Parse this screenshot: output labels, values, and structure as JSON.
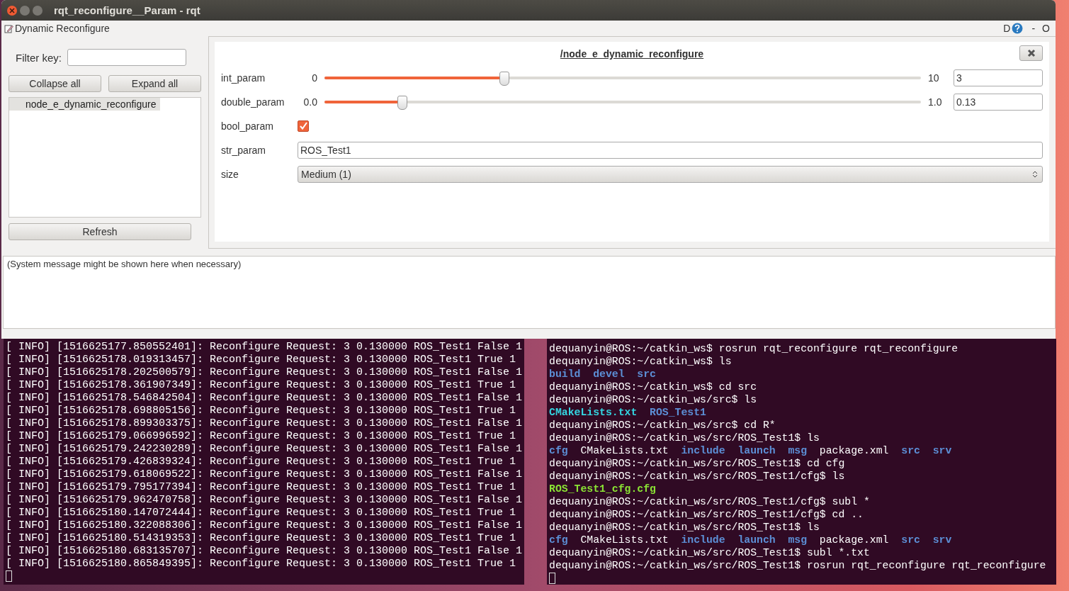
{
  "window": {
    "title": "rqt_reconfigure__Param - rqt"
  },
  "plugin": {
    "title": "Dynamic Reconfigure",
    "controls": [
      "D",
      "-",
      "O"
    ]
  },
  "filter": {
    "label": "Filter key:"
  },
  "buttons": [
    "Collapse all",
    "Expand all"
  ],
  "tree": [
    {
      "label": "node_e_dynamic_reconfigure",
      "selected": true
    }
  ],
  "refresh": "Refresh",
  "node": {
    "title": "/node_e_dynamic_reconfigure",
    "params": [
      {
        "kind": "slider",
        "name": "int_param",
        "min": "0",
        "max": "10",
        "level": 0.3,
        "value": "3"
      },
      {
        "kind": "slider",
        "name": "double_param",
        "min": "0.0",
        "max": "1.0",
        "level": 0.13,
        "value": "0.13"
      },
      {
        "kind": "checkbox",
        "name": "bool_param",
        "checked": true
      },
      {
        "kind": "text",
        "name": "str_param",
        "value": "ROS_Test1"
      },
      {
        "kind": "dropdown",
        "name": "size",
        "value": "Medium (1)"
      }
    ]
  },
  "message": "(System message might be shown here when necessary)",
  "terminal_left": {
    "lines": [
      "[ INFO] [1516625177.850552401]: Reconfigure Request: 3 0.130000 ROS_Test1 False 1",
      "[ INFO] [1516625178.019313457]: Reconfigure Request: 3 0.130000 ROS_Test1 True 1",
      "[ INFO] [1516625178.202500579]: Reconfigure Request: 3 0.130000 ROS_Test1 False 1",
      "[ INFO] [1516625178.361907349]: Reconfigure Request: 3 0.130000 ROS_Test1 True 1",
      "[ INFO] [1516625178.546842504]: Reconfigure Request: 3 0.130000 ROS_Test1 False 1",
      "[ INFO] [1516625178.698805156]: Reconfigure Request: 3 0.130000 ROS_Test1 True 1",
      "[ INFO] [1516625178.899303375]: Reconfigure Request: 3 0.130000 ROS_Test1 False 1",
      "[ INFO] [1516625179.066996592]: Reconfigure Request: 3 0.130000 ROS_Test1 True 1",
      "[ INFO] [1516625179.242230289]: Reconfigure Request: 3 0.130000 ROS_Test1 False 1",
      "[ INFO] [1516625179.426839324]: Reconfigure Request: 3 0.130000 ROS_Test1 True 1",
      "[ INFO] [1516625179.618069522]: Reconfigure Request: 3 0.130000 ROS_Test1 False 1",
      "[ INFO] [1516625179.795177394]: Reconfigure Request: 3 0.130000 ROS_Test1 True 1",
      "[ INFO] [1516625179.962470758]: Reconfigure Request: 3 0.130000 ROS_Test1 False 1",
      "[ INFO] [1516625180.147072444]: Reconfigure Request: 3 0.130000 ROS_Test1 True 1",
      "[ INFO] [1516625180.322088306]: Reconfigure Request: 3 0.130000 ROS_Test1 False 1",
      "[ INFO] [1516625180.514319353]: Reconfigure Request: 3 0.130000 ROS_Test1 True 1",
      "[ INFO] [1516625180.683135707]: Reconfigure Request: 3 0.130000 ROS_Test1 False 1",
      "[ INFO] [1516625180.865849395]: Reconfigure Request: 3 0.130000 ROS_Test1 True 1"
    ]
  },
  "terminal_right": {
    "lines": [
      {
        "kind": "prompt",
        "prompt": "dequanyin@ROS:~/catkin_ws$",
        "command": "rosrun rqt_reconfigure rqt_reconfigure"
      },
      {
        "kind": "prompt",
        "prompt": "dequanyin@ROS:~/catkin_ws$",
        "command": "ls"
      },
      {
        "kind": "listing",
        "entries": [
          {
            "text": "build",
            "color": "#5c8fd6",
            "bold": true
          },
          {
            "text": "devel",
            "color": "#5c8fd6",
            "bold": true
          },
          {
            "text": "src",
            "color": "#5c8fd6",
            "bold": true
          }
        ]
      },
      {
        "kind": "prompt",
        "prompt": "dequanyin@ROS:~/catkin_ws$",
        "command": "cd src"
      },
      {
        "kind": "prompt",
        "prompt": "dequanyin@ROS:~/catkin_ws/src$",
        "command": "ls"
      },
      {
        "kind": "listing",
        "entries": [
          {
            "text": "CMakeLists.txt",
            "color": "#34d6e2",
            "bold": true
          },
          {
            "text": "ROS_Test1",
            "color": "#5c8fd6",
            "bold": true
          }
        ]
      },
      {
        "kind": "prompt",
        "prompt": "dequanyin@ROS:~/catkin_ws/src$",
        "command": "cd R*"
      },
      {
        "kind": "prompt",
        "prompt": "dequanyin@ROS:~/catkin_ws/src/ROS_Test1$",
        "command": "ls"
      },
      {
        "kind": "listing",
        "entries": [
          {
            "text": "cfg",
            "color": "#5c8fd6",
            "bold": true
          },
          {
            "text": "CMakeLists.txt",
            "color": "#ffffff",
            "bold": false
          },
          {
            "text": "include",
            "color": "#5c8fd6",
            "bold": true
          },
          {
            "text": "launch",
            "color": "#5c8fd6",
            "bold": true
          },
          {
            "text": "msg",
            "color": "#5c8fd6",
            "bold": true
          },
          {
            "text": "package.xml",
            "color": "#ffffff",
            "bold": false
          },
          {
            "text": "src",
            "color": "#5c8fd6",
            "bold": true
          },
          {
            "text": "srv",
            "color": "#5c8fd6",
            "bold": true
          }
        ]
      },
      {
        "kind": "prompt",
        "prompt": "dequanyin@ROS:~/catkin_ws/src/ROS_Test1$",
        "command": "cd cfg"
      },
      {
        "kind": "prompt",
        "prompt": "dequanyin@ROS:~/catkin_ws/src/ROS_Test1/cfg$",
        "command": "ls"
      },
      {
        "kind": "listing",
        "entries": [
          {
            "text": "ROS_Test1_cfg.cfg",
            "color": "#8ae234",
            "bold": true
          }
        ]
      },
      {
        "kind": "prompt",
        "prompt": "dequanyin@ROS:~/catkin_ws/src/ROS_Test1/cfg$",
        "command": "subl *"
      },
      {
        "kind": "prompt",
        "prompt": "dequanyin@ROS:~/catkin_ws/src/ROS_Test1/cfg$",
        "command": "cd .."
      },
      {
        "kind": "prompt",
        "prompt": "dequanyin@ROS:~/catkin_ws/src/ROS_Test1$",
        "command": "ls"
      },
      {
        "kind": "listing",
        "entries": [
          {
            "text": "cfg",
            "color": "#5c8fd6",
            "bold": true
          },
          {
            "text": "CMakeLists.txt",
            "color": "#ffffff",
            "bold": false
          },
          {
            "text": "include",
            "color": "#5c8fd6",
            "bold": true
          },
          {
            "text": "launch",
            "color": "#5c8fd6",
            "bold": true
          },
          {
            "text": "msg",
            "color": "#5c8fd6",
            "bold": true
          },
          {
            "text": "package.xml",
            "color": "#ffffff",
            "bold": false
          },
          {
            "text": "src",
            "color": "#5c8fd6",
            "bold": true
          },
          {
            "text": "srv",
            "color": "#5c8fd6",
            "bold": true
          }
        ]
      },
      {
        "kind": "prompt",
        "prompt": "dequanyin@ROS:~/catkin_ws/src/ROS_Test1$",
        "command": "subl *.txt"
      },
      {
        "kind": "prompt",
        "prompt": "dequanyin@ROS:~/catkin_ws/src/ROS_Test1$",
        "command": "rosrun rqt_reconfigure rqt_reconfigure"
      }
    ]
  }
}
